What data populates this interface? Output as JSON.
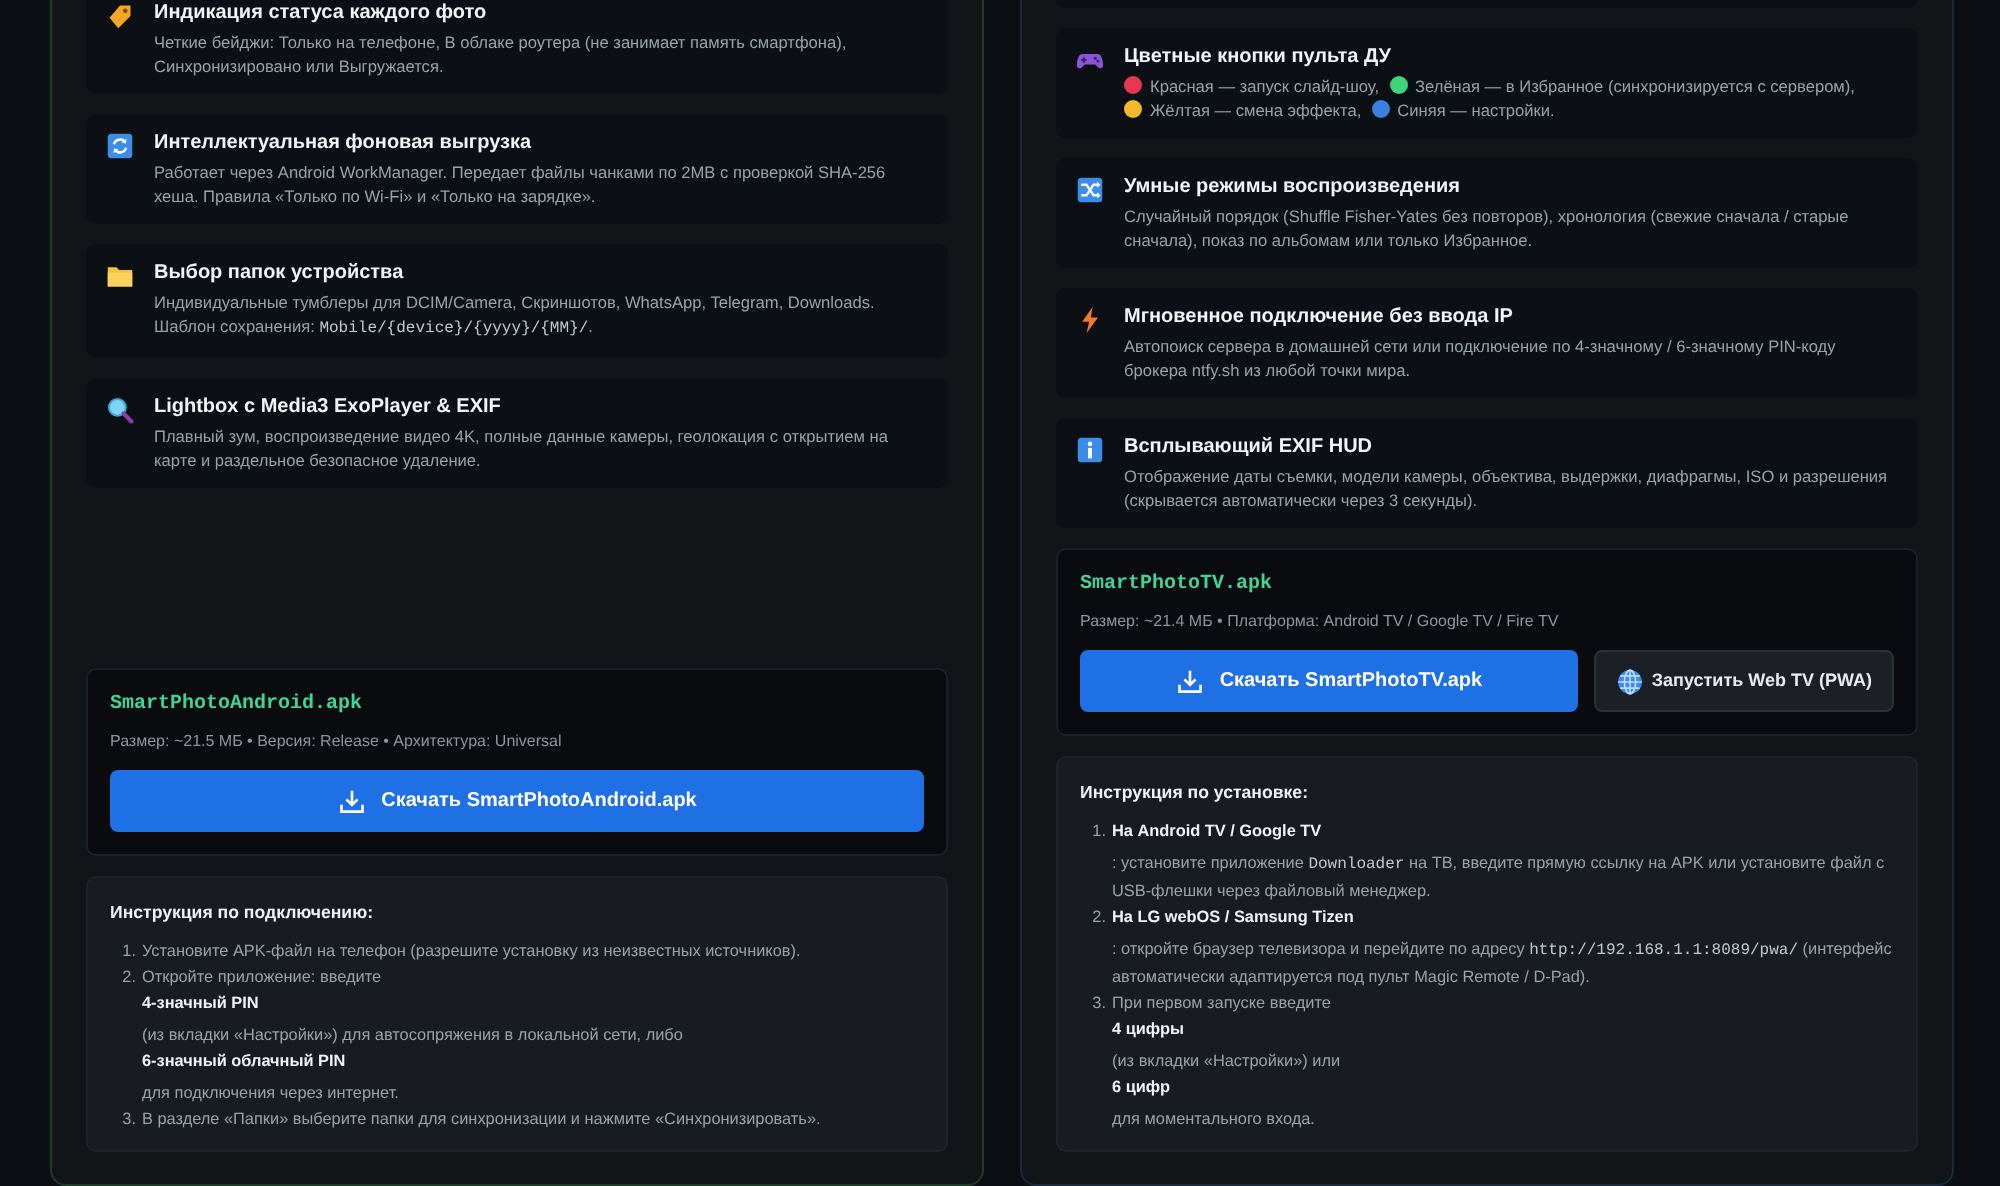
{
  "panels": [
    {
      "color": "#1d3a2b",
      "features": [
        {
          "title": "Индикация статуса каждого фото",
          "parts": [
            {
              "kind": "text",
              "text": "Четкие бейджи: Только  на  телефоне, В  облаке  роутера (не занимает память смартфона), Синхронизировано или Выгружается."
            }
          ]
        },
        {
          "title": "Интеллектуальная фоновая выгрузка",
          "parts": [
            {
              "kind": "text",
              "text": "Работает через Android WorkManager. Передает файлы чанками по 2MB с проверкой SHA-256 хеша. Правила «Только по Wi-Fi» и «Только на зарядке»."
            }
          ]
        },
        {
          "title": "Выбор папок устройства",
          "parts": [
            {
              "kind": "text",
              "text": "Индивидуальные тумблеры для DCIM/Camera, Скриншотов, WhatsApp, Telegram, Downloads. Шаблон сохранения: "
            },
            {
              "kind": "code",
              "text": "Mobile/{device}/{yyyy}/{MM}/"
            },
            {
              "kind": "text",
              "text": "."
            }
          ]
        },
        {
          "title": "Lightbox с Media3 ExoPlayer & EXIF",
          "parts": [
            {
              "kind": "text",
              "text": "Плавный зум, воспроизведение видео 4K, полные данные камеры, геолокация с открытием на карте и раздельное безопасное удаление."
            }
          ]
        }
      ],
      "apk": {
        "file": "SmartPhotoAndroid.apk",
        "meta": "Размер: ~21.5 МБ • Версия: Release • Архитектура: Universal",
        "buttons": [
          {
            "kind": "primary",
            "label": "Скачать SmartPhotoAndroid.apk"
          }
        ]
      },
      "instructions": {
        "title": "Инструкция по подключению:",
        "steps": [
          {
            "number": "1.",
            "parts": [
              {
                "kind": "text",
                "text": "Установите APK-файл на телефон (разрешите установку из неизвестных источников)."
              }
            ]
          },
          {
            "number": "2.",
            "parts": [
              {
                "kind": "text",
                "text": "Откройте приложение: введите"
              },
              {
                "kind": "strong",
                "text": "4-значный PIN"
              },
              {
                "kind": "text",
                "text": "(из вкладки «Настройки») для автосопряжения в локальной сети, либо"
              },
              {
                "kind": "strong",
                "text": "6-значный облачный PIN"
              },
              {
                "kind": "text",
                "text": "для подключения через интернет."
              }
            ]
          },
          {
            "number": "3.",
            "parts": [
              {
                "kind": "text",
                "text": "В разделе «Папки» выберите папки для синхронизации и нажмите «Синхронизировать»."
              }
            ]
          }
        ]
      }
    },
    {
      "color": "#1c2a3d",
      "features": [
        {
          "title": "Цветные кнопки пульта ДУ",
          "parts": [
            {
              "kind": "dot",
              "color": "#e5384f"
            },
            {
              "kind": "text",
              "text": "Красная — запуск слайд-шоу,"
            },
            {
              "kind": "dot",
              "color": "#3fd47a"
            },
            {
              "kind": "text",
              "text": "Зелёная — в Избранное (синхронизируется с сервером),"
            },
            {
              "kind": "dot",
              "color": "#f2b92c"
            },
            {
              "kind": "text",
              "text": "Жёлтая — смена эффекта,"
            },
            {
              "kind": "dot",
              "color": "#3b7fe0"
            },
            {
              "kind": "text",
              "text": "Синяя — настройки."
            }
          ]
        },
        {
          "title": "Умные режимы воспроизведения",
          "parts": [
            {
              "kind": "text",
              "text": "Случайный порядок (Shuffle Fisher-Yates без повторов), хронология (свежие сначала / старые сначала), показ по альбомам или только Избранное."
            }
          ]
        },
        {
          "title": "Мгновенное подключение без ввода IP",
          "parts": [
            {
              "kind": "text",
              "text": "Автопоиск сервера в домашней сети или подключение по 4-значному / 6-значному PIN-коду брокера ntfy.sh из любой точки мира."
            }
          ]
        },
        {
          "title": "Всплывающий EXIF HUD",
          "parts": [
            {
              "kind": "text",
              "text": "Отображение даты съемки, модели камеры, объектива, выдержки, диафрагмы, ISO и разрешения (скрывается автоматически через 3 секунды)."
            }
          ]
        }
      ],
      "apk": {
        "file": "SmartPhotoTV.apk",
        "meta": "Размер: ~21.4 МБ • Платформа: Android TV / Google TV / Fire TV",
        "buttons": [
          {
            "kind": "primary",
            "label": "Скачать SmartPhotoTV.apk"
          },
          {
            "kind": "secondary",
            "label": "Запустить Web TV (PWA)"
          }
        ]
      },
      "instructions": {
        "title": "Инструкция по установке:",
        "steps": [
          {
            "number": "1.",
            "parts": [
              {
                "kind": "strong",
                "text": "На Android TV / Google TV"
              },
              {
                "kind": "text",
                "text": ": установите приложение "
              },
              {
                "kind": "code",
                "text": "Downloader"
              },
              {
                "kind": "text",
                "text": " на ТВ, введите прямую ссылку на APK или установите файл с USB-флешки через файловый менеджер."
              }
            ]
          },
          {
            "number": "2.",
            "parts": [
              {
                "kind": "strong",
                "text": "На LG webOS / Samsung Tizen"
              },
              {
                "kind": "text",
                "text": ": откройте браузер телевизора и перейдите по адресу "
              },
              {
                "kind": "code",
                "text": "http://192.168.1.1:8089/pwa/"
              },
              {
                "kind": "text",
                "text": " (интерфейс автоматически адаптируется под пульт Magic Remote / D-Pad)."
              }
            ]
          },
          {
            "number": "3.",
            "parts": [
              {
                "kind": "text",
                "text": "При первом запуске введите"
              },
              {
                "kind": "strong",
                "text": "4 цифры"
              },
              {
                "kind": "text",
                "text": "(из вкладки «Настройки») или"
              },
              {
                "kind": "strong",
                "text": "6 цифр"
              },
              {
                "kind": "text",
                "text": "для моментального входа."
              }
            ]
          }
        ]
      }
    }
  ]
}
